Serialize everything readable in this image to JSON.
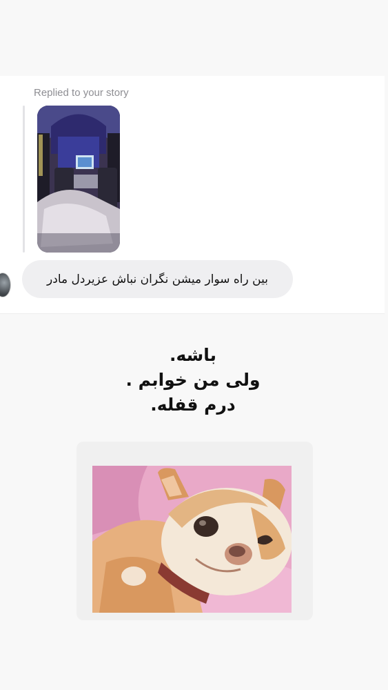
{
  "reply": {
    "caption": "Replied to your story"
  },
  "message": {
    "text": "بین راه سوار میشن نگران نباش عزیردل مادر"
  },
  "story": {
    "line1": "باشه.",
    "line2": "ولی من خوابم .",
    "line3": "درم قفله."
  },
  "colors": {
    "page_background": "#f8f8f8",
    "dm_panel": "#ffffff",
    "bubble": "#efeff1",
    "caption": "#8e8e93"
  },
  "icons": {
    "story_thumbnail": "train-cabin-photo",
    "avatar": "user-avatar",
    "sticker": "chihuahua-photo"
  }
}
